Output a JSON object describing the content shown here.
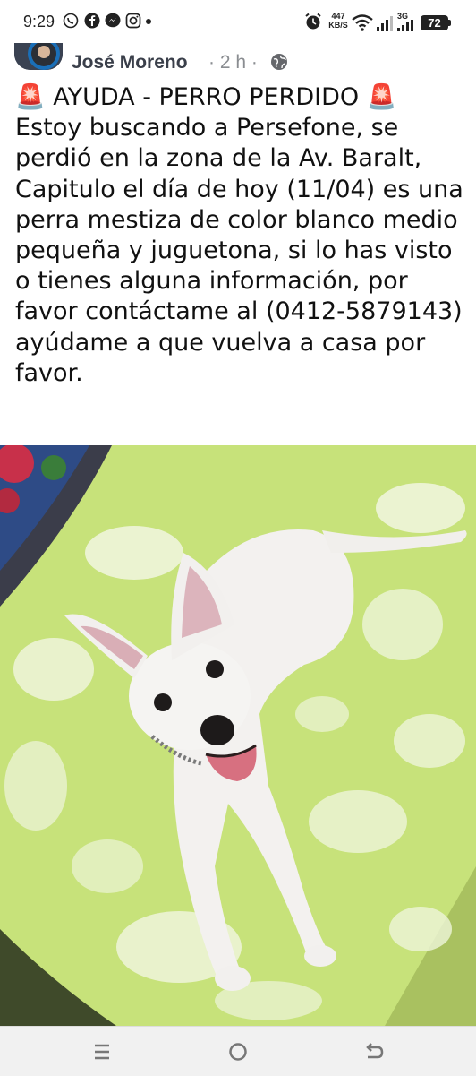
{
  "status_bar": {
    "time": "9:29",
    "network_speed_value": "447",
    "network_speed_unit": "KB/S",
    "network_type": "3G",
    "battery": "72",
    "icons": [
      "whatsapp-icon",
      "facebook-icon",
      "messenger-icon",
      "instagram-icon",
      "notification-dot-icon",
      "alarm-icon",
      "wifi-icon",
      "signal-icon",
      "signal-3g-icon",
      "battery-icon"
    ]
  },
  "post": {
    "author": "José Moreno",
    "time_ago": "· 2 h ·",
    "privacy_icon": "globe-icon",
    "alert_icon": "police-light-icon",
    "text": "🚨 AYUDA - PERRO PERDIDO 🚨\nEstoy buscando a Persefone, se perdió en la zona de la Av. Baralt, Capitulo  el día de hoy (11/04) es una perra mestiza de color blanco medio pequeña y juguetona, si lo has visto o tienes alguna información, por favor contáctame al (0412-5879143) ayúdame a que vuelva a casa por favor.",
    "photo": "white dog lying on green bedspread"
  },
  "nav_bar": {
    "buttons": [
      "recent-apps-icon",
      "home-icon",
      "back-icon"
    ]
  },
  "colors": {
    "author": "#3a3f4a",
    "meta": "#8a8d91",
    "text": "#111111",
    "siren": "#e0202a",
    "bedspread": "#c7e27a"
  }
}
